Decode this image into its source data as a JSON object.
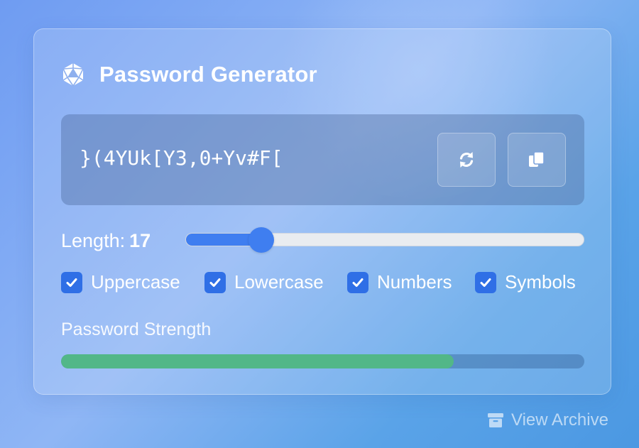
{
  "app": {
    "title": "Password Generator",
    "icon": "dice-d20-icon"
  },
  "password": {
    "value": "}(4YUk[Y3,0+Yv#F[",
    "actions": [
      {
        "name": "refresh",
        "icon": "refresh-icon"
      },
      {
        "name": "copy",
        "icon": "copy-icon"
      }
    ]
  },
  "length": {
    "label": "Length:",
    "value": "17",
    "slider_fraction": 0.19
  },
  "options": [
    {
      "label": "Uppercase",
      "checked": true
    },
    {
      "label": "Lowercase",
      "checked": true
    },
    {
      "label": "Numbers",
      "checked": true
    },
    {
      "label": "Symbols",
      "checked": true
    }
  ],
  "strength": {
    "label": "Password Strength",
    "level": 0.75,
    "color": "#52b788"
  },
  "footer": {
    "archive_label": "View Archive",
    "archive_icon": "archive-box-icon"
  },
  "colors": {
    "accent": "#3f7ef0",
    "checkbox": "#2f6fe6",
    "strength_good": "#52b788"
  }
}
